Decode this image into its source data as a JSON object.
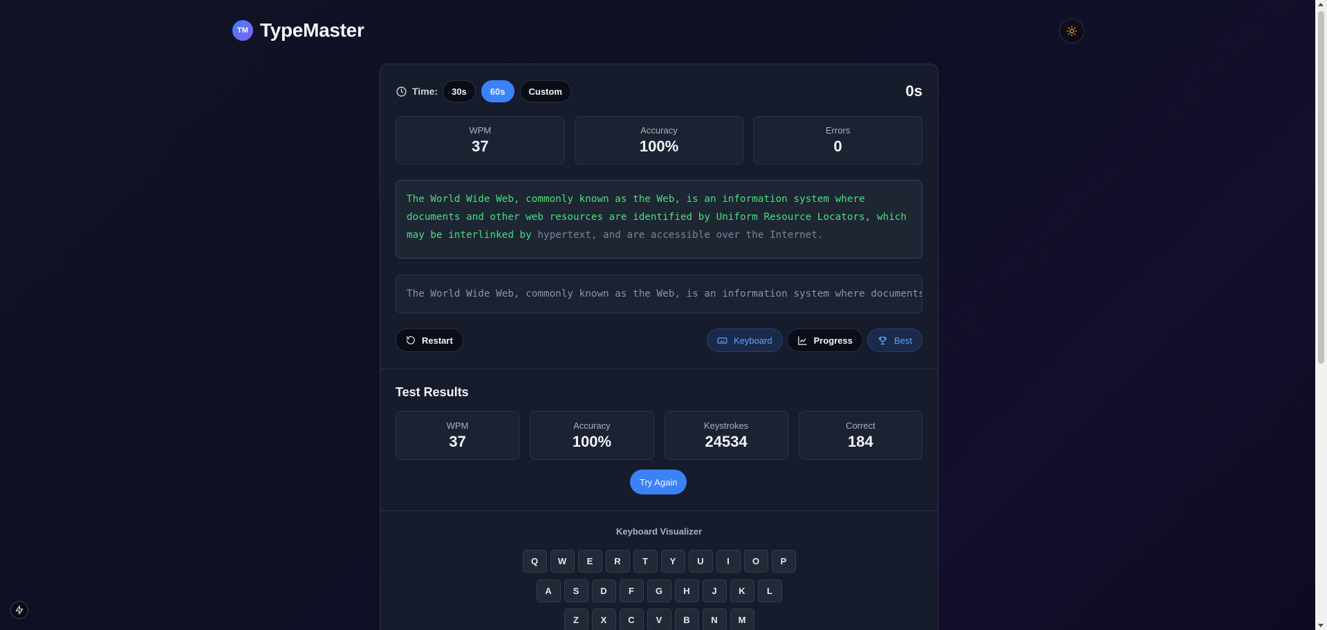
{
  "header": {
    "logo_text": "TM",
    "title": "TypeMaster"
  },
  "topbar": {
    "time_label": "Time:",
    "options": [
      "30s",
      "60s",
      "Custom"
    ],
    "selected_option": "60s",
    "timer": "0s"
  },
  "stats": [
    {
      "label": "WPM",
      "value": "37"
    },
    {
      "label": "Accuracy",
      "value": "100%"
    },
    {
      "label": "Errors",
      "value": "0"
    }
  ],
  "passage": {
    "typed": "The World Wide Web, commonly known as the Web, is an information system where documents and other web resources are identified by Uniform Resource Locators, which may be interlinked by",
    "untyped": " hypertext, and are accessible over the Internet."
  },
  "input": {
    "value": "The World Wide Web, commonly known as the Web, is an information system where documents and other web resources are identified by Uniform Resource Locators, which may be interlinked by"
  },
  "actions": {
    "restart": "Restart",
    "keyboard": "Keyboard",
    "progress": "Progress",
    "best": "Best"
  },
  "results": {
    "title": "Test Results",
    "items": [
      {
        "label": "WPM",
        "value": "37"
      },
      {
        "label": "Accuracy",
        "value": "100%"
      },
      {
        "label": "Keystrokes",
        "value": "24534"
      },
      {
        "label": "Correct",
        "value": "184"
      }
    ],
    "try_again": "Try Again"
  },
  "keyboard": {
    "title": "Keyboard Visualizer",
    "rows": [
      [
        "Q",
        "W",
        "E",
        "R",
        "T",
        "Y",
        "U",
        "I",
        "O",
        "P"
      ],
      [
        "A",
        "S",
        "D",
        "F",
        "G",
        "H",
        "J",
        "K",
        "L"
      ],
      [
        "Z",
        "X",
        "C",
        "V",
        "B",
        "N",
        "M"
      ]
    ]
  },
  "colors": {
    "accent": "#3b82f6",
    "typed_text": "#4ade80",
    "untyped_text": "#7c8494",
    "sun_icon": "#f5a623"
  }
}
